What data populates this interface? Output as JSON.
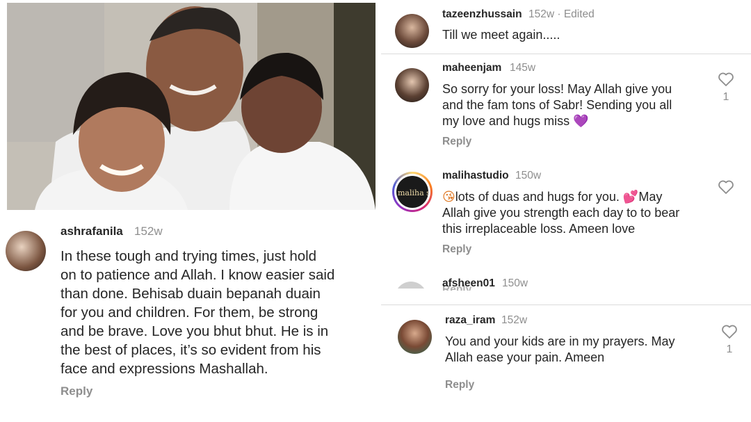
{
  "left_post": {
    "comment": {
      "username": "ashrafanila",
      "time": "152w",
      "text": "In these tough and trying times, just hold\non to patience and Allah. I know easier said\nthan done. Behisab duain bepanah duain\nfor you and children. For them, be strong\nand be brave. Love you bhut bhut. He is in\nthe best of places, it’s so evident from his\nface and expressions Mashallah.",
      "reply": "Reply"
    }
  },
  "right_comments": [
    {
      "username": "tazeenzhussain",
      "time": "152w · Edited",
      "text": "Till we meet again.....",
      "reply": "",
      "likes": ""
    },
    {
      "username": "maheenjam",
      "time": "145w",
      "text": "So sorry for your loss! May Allah give you\nand the fam tons of Sabr! Sending you all\nmy love and hugs miss",
      "emoji": "💜",
      "reply": "Reply",
      "likes": "1"
    },
    {
      "username": "malihastudio",
      "time": "150w",
      "emoji_lead": "😘",
      "text_a": "lots of duas and hugs for you. ",
      "emoji_mid": "💕",
      "text_b": "May\nAllah give you strength each day to  to bear\nthis irreplaceable loss. Ameen love",
      "avatar_text": "maliha s",
      "reply": "Reply",
      "likes": ""
    },
    {
      "username": "afsheen01",
      "time": "150w",
      "reply": "Reply"
    },
    {
      "username": "raza_iram",
      "time": "152w",
      "text": "You and your kids are in my prayers. May\nAllah ease your pain. Ameen",
      "reply": "Reply",
      "likes": "1"
    }
  ],
  "colors": {
    "muted": "#8e8e8e",
    "text": "#262626",
    "story_ring": "#c13584",
    "divider": "#dbdbdb"
  },
  "icons": {
    "like": "heart-outline-icon"
  }
}
